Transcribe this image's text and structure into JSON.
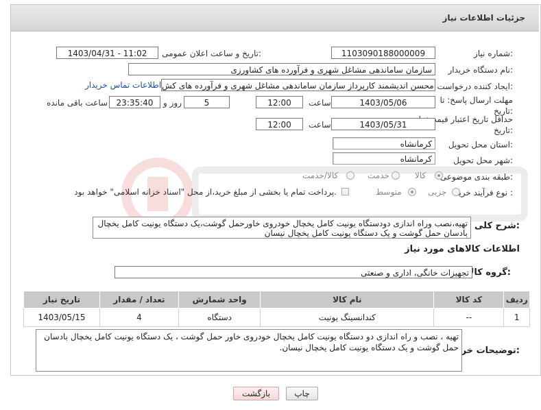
{
  "header": {
    "title": "جزئیات اطلاعات نیاز"
  },
  "fields": {
    "need_number_label": "شماره نیاز:",
    "need_number": "1103090188000009",
    "announce_label": "تاریخ و ساعت اعلان عمومی:",
    "announce_value": "1403/04/31 - 11:02",
    "buyer_org_label": "نام دستگاه خریدار:",
    "buyer_org": "سازمان ساماندهی مشاغل شهری و فرآورده های کشاورزی",
    "creator_label": "ایجاد کننده درخواست:",
    "creator": "محسن اندیشمند کارپرداز سازمان ساماندهی مشاغل شهری و فرآورده های کش",
    "contact_link": "اطلاعات تماس خریدار",
    "deadline_label": "مهلت ارسال پاسخ: تا تاریخ:",
    "deadline_date": "1403/05/06",
    "hour_label": "ساعت",
    "deadline_time": "12:00",
    "days_value": "5",
    "days_label": "روز و",
    "remaining_time": "23:35:40",
    "remaining_label": "ساعت باقی مانده",
    "validity_label": "حداقل تاریخ اعتبار قیمت: تا تاریخ:",
    "validity_date": "1403/05/31",
    "validity_hour_label": "ساعت",
    "validity_time": "12:00",
    "province_label": "استان محل تحویل:",
    "province": "کرمانشاه",
    "city_label": "شهر محل تحویل:",
    "city": "کرمانشاه",
    "category_label": "طبقه بندی موضوعی:",
    "category_options": [
      "کالا",
      "خدمت",
      "کالا/خدمت"
    ],
    "process_label": "نوع فرآیند خرید :",
    "process_options": [
      "جزیی",
      "متوسط"
    ],
    "payment_note": "پرداخت تمام یا بخشی از مبلغ خرید،از محل \"اسناد خزانه اسلامی\" خواهد بود.",
    "description_label": "شرح کلی نیاز:",
    "description": "تهیه،نصب وراه اندازی دودستگاه یونیت کامل یخچال خودروی خاورحمل گوشت،یک دستگاه یونیت کامل یخچال بادسان حمل گوشت و یک دستگاه یونیت کامل یخچال نیسان"
  },
  "goods": {
    "section_title": "اطلاعات کالاهای مورد نیاز",
    "group_label": "گروه کالا:",
    "group_value": "تجهیزات خانگی، اداری و صنعتی",
    "columns": [
      "ردیف",
      "کد کالا",
      "نام کالا",
      "واحد شمارش",
      "تعداد / مقدار",
      "تاریخ نیاز"
    ],
    "rows": [
      {
        "row": "1",
        "code": "--",
        "name": "کندانسینگ یونیت",
        "unit": "دستگاه",
        "qty": "4",
        "date": "1403/05/15"
      }
    ]
  },
  "buyer_notes": {
    "label": "توضیحات خریدار:",
    "text": "تهیه ، نصب و راه اندازی دو دستگاه یونیت کامل یخچال خودروی خاور حمل گوشت ، یک دستگاه یونیت کامل یخچال بادسان حمل گوشت و یک دستگاه یونیت کامل یخچال نیسان."
  },
  "buttons": {
    "print": "چاپ",
    "back": "بازگشت"
  },
  "colors": {
    "link": "#1a4fa0",
    "header_bg": "#c9c9c9",
    "back_btn": "#f3d9d9"
  },
  "icons": {
    "watermark": "ariatender-watermark",
    "resize": "resize-grip-icon"
  }
}
